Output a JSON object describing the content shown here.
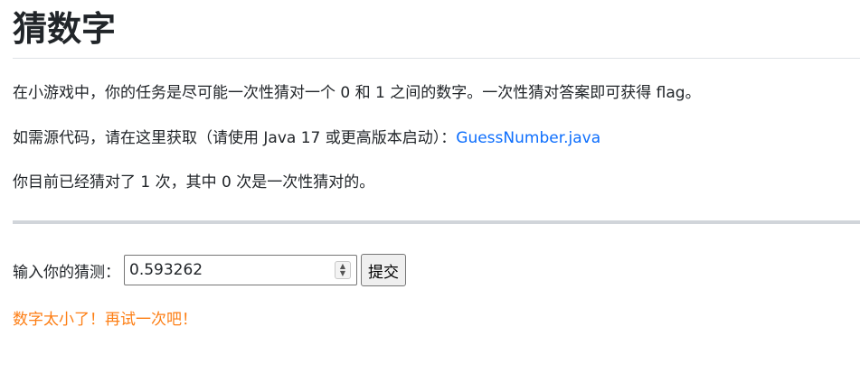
{
  "header": {
    "title": "猜数字"
  },
  "intro": {
    "task_text": "在小游戏中，你的任务是尽可能一次性猜对一个 0 和 1 之间的数字。一次性猜对答案即可获得 flag。",
    "source_prefix": "如需源代码，请在这里获取（请使用 Java 17 或更高版本启动）：",
    "source_link_text": "GuessNumber.java",
    "stats_text": "你目前已经猜对了 1 次，其中 0 次是一次性猜对的。"
  },
  "form": {
    "label": "输入你的猜测：",
    "guess_value": "0.593262",
    "submit_label": "提交"
  },
  "result": {
    "message": "数字太小了！再试一次吧！",
    "color": "#fd7e14"
  },
  "colors": {
    "link": "#0d6efd",
    "text": "#212529"
  }
}
